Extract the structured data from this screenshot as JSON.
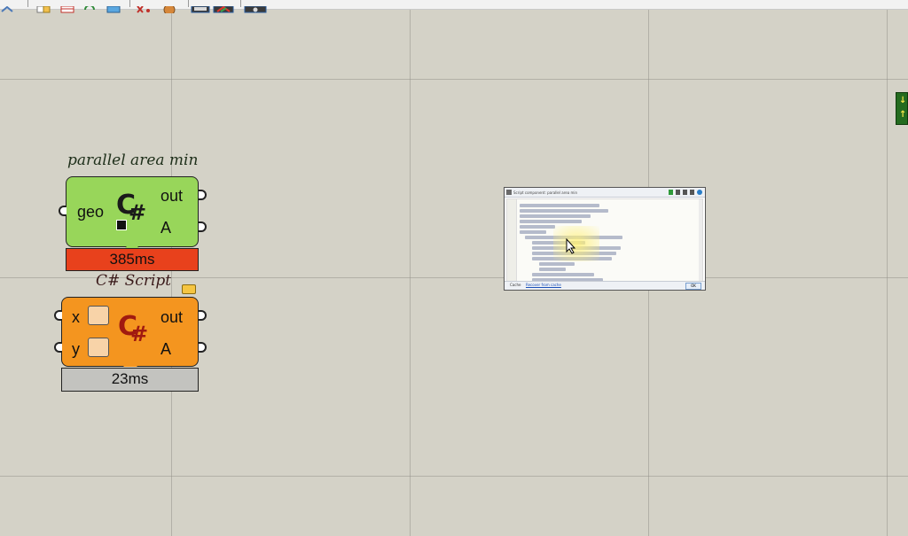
{
  "toolbar": {
    "icons": [
      "document-icon",
      "table-icon",
      "refresh-icon",
      "blue-box-icon",
      "red-x-icon",
      "cookie-icon",
      "blue-panel-icon",
      "red-green-icon",
      "camera-icon"
    ]
  },
  "components": {
    "parallel": {
      "title": "parallel area min",
      "input": "geo",
      "outputs": [
        "out",
        "A"
      ],
      "timer": "385ms",
      "color": "#98d65a",
      "timer_color": "#e8411c"
    },
    "script": {
      "title": "C# Script",
      "inputs": [
        "x",
        "y"
      ],
      "outputs": [
        "out",
        "A"
      ],
      "timer": "23ms",
      "color": "#f4951f",
      "timer_color": "#c3c3bf"
    }
  },
  "logo": {
    "c": "C",
    "hash": "#"
  },
  "editor_popup": {
    "window_title": "Script component: parallel area min",
    "footer_tab": "Cache",
    "footer_link": "Recover from cache",
    "footer_button": "OK"
  },
  "side_widget": {
    "up": "↓",
    "down": "↑"
  }
}
